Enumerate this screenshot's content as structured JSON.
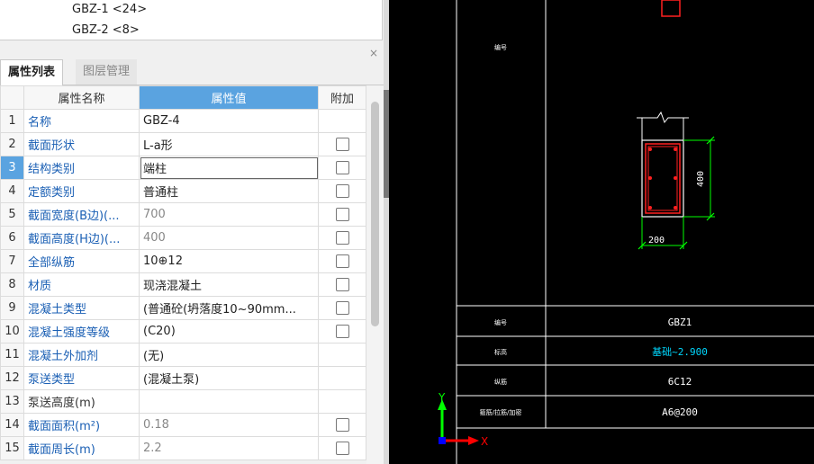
{
  "tree": {
    "items": [
      "GBZ-1 <24>",
      "GBZ-2 <8>"
    ]
  },
  "panel": {
    "close_glyph": "×",
    "tabs": [
      {
        "label": "属性列表",
        "active": true
      },
      {
        "label": "图层管理",
        "active": false
      }
    ],
    "columns": {
      "index": "",
      "name": "属性名称",
      "value": "属性值",
      "extra": "附加"
    },
    "selected_row": 3,
    "rows": [
      {
        "num": "1",
        "name": "名称",
        "value": "GBZ-4",
        "checkbox": false,
        "value_gray": false,
        "name_link": true
      },
      {
        "num": "2",
        "name": "截面形状",
        "value": "L-a形",
        "checkbox": true,
        "value_gray": false,
        "name_link": true
      },
      {
        "num": "3",
        "name": "结构类别",
        "value": "端柱",
        "checkbox": true,
        "value_gray": false,
        "name_link": true
      },
      {
        "num": "4",
        "name": "定额类别",
        "value": "普通柱",
        "checkbox": true,
        "value_gray": false,
        "name_link": true
      },
      {
        "num": "5",
        "name": "截面宽度(B边)(...",
        "value": "700",
        "checkbox": true,
        "value_gray": true,
        "name_link": true
      },
      {
        "num": "6",
        "name": "截面高度(H边)(...",
        "value": "400",
        "checkbox": true,
        "value_gray": true,
        "name_link": true
      },
      {
        "num": "7",
        "name": "全部纵筋",
        "value": "10⊕12",
        "checkbox": true,
        "value_gray": false,
        "name_link": true
      },
      {
        "num": "8",
        "name": "材质",
        "value": "现浇混凝土",
        "checkbox": true,
        "value_gray": false,
        "name_link": true
      },
      {
        "num": "9",
        "name": "混凝土类型",
        "value": "(普通砼(坍落度10~90mm...",
        "checkbox": true,
        "value_gray": false,
        "name_link": true
      },
      {
        "num": "10",
        "name": "混凝土强度等级",
        "value": "(C20)",
        "checkbox": true,
        "value_gray": false,
        "name_link": true
      },
      {
        "num": "11",
        "name": "混凝土外加剂",
        "value": "(无)",
        "checkbox": false,
        "value_gray": false,
        "name_link": true
      },
      {
        "num": "12",
        "name": "泵送类型",
        "value": "(混凝土泵)",
        "checkbox": false,
        "value_gray": false,
        "name_link": true
      },
      {
        "num": "13",
        "name": "泵送高度(m)",
        "value": "",
        "checkbox": false,
        "value_gray": false,
        "name_link": false
      },
      {
        "num": "14",
        "name": "截面面积(m²)",
        "value": "0.18",
        "checkbox": true,
        "value_gray": true,
        "name_link": true
      },
      {
        "num": "15",
        "name": "截面周长(m)",
        "value": "2.2",
        "checkbox": true,
        "value_gray": true,
        "name_link": true
      }
    ]
  },
  "cad": {
    "dim_vertical": "400",
    "dim_horizontal": "200",
    "side_label_top": "编号",
    "table_rows": [
      {
        "label": "编号",
        "value": "GBZ1"
      },
      {
        "label": "标高",
        "value": "基础~2.900"
      },
      {
        "label": "纵筋",
        "value": "6C12"
      },
      {
        "label": "箍筋/拉筋/加密",
        "value": "A6@200"
      }
    ],
    "axis_y": "Y",
    "axis_x": "X",
    "colors": {
      "background": "#000000",
      "lines": "#ffffff",
      "dimension": "#00ff00",
      "rebar": "#ff2020",
      "axis_y": "#00ff00",
      "axis_x": "#ff0000",
      "origin": "#0000ff"
    }
  }
}
